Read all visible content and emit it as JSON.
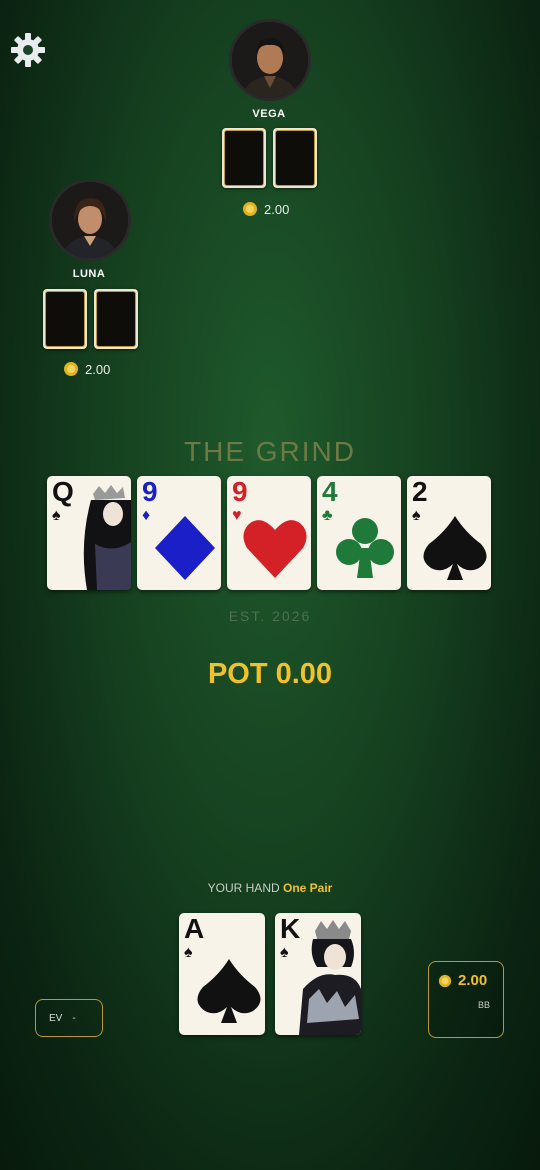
{
  "settings": {
    "icon": "gear-icon"
  },
  "players": [
    {
      "name": "VEGA",
      "stack": "2.00"
    },
    {
      "name": "LUNA",
      "stack": "2.00"
    }
  ],
  "table": {
    "title": "THE GRIND",
    "est": "EST. 2026",
    "pot_label": "POT 0.00"
  },
  "board": [
    {
      "rank": "Q",
      "suit": "spades",
      "color": "#111111"
    },
    {
      "rank": "9",
      "suit": "diamonds",
      "color": "#1b1fc7"
    },
    {
      "rank": "9",
      "suit": "hearts",
      "color": "#d42027"
    },
    {
      "rank": "4",
      "suit": "clubs",
      "color": "#1f7a3a"
    },
    {
      "rank": "2",
      "suit": "spades",
      "color": "#111111"
    }
  ],
  "hero": {
    "hand_label": "YOUR HAND",
    "hand_value": "One Pair",
    "cards": [
      {
        "rank": "A",
        "suit": "spades",
        "color": "#111111"
      },
      {
        "rank": "K",
        "suit": "spades",
        "color": "#111111"
      }
    ],
    "ev_label": "EV",
    "ev_value": "-",
    "bet_amount": "2.00",
    "bet_unit": "BB"
  },
  "colors": {
    "accent_gold": "#f0c12a",
    "border_gold": "#b8963e",
    "felt": "#1f5a2c"
  }
}
